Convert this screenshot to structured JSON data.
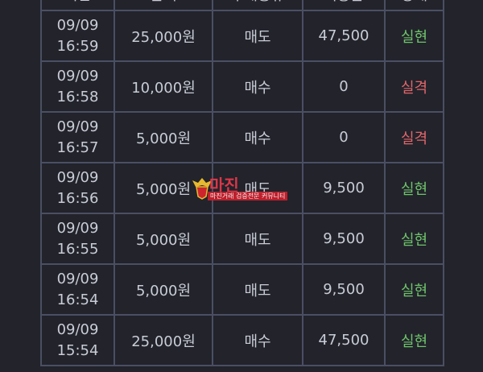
{
  "table": {
    "headers": [
      "시간",
      "금액",
      "구매종류",
      "적중금",
      "상태"
    ],
    "rows": [
      {
        "date": "09/09",
        "time": "16:59",
        "amount": "25,000원",
        "type": "매도",
        "payout": "47,500",
        "status": "실현"
      },
      {
        "date": "09/09",
        "time": "16:58",
        "amount": "10,000원",
        "type": "매수",
        "payout": "0",
        "status": "실격"
      },
      {
        "date": "09/09",
        "time": "16:57",
        "amount": "5,000원",
        "type": "매수",
        "payout": "0",
        "status": "실격"
      },
      {
        "date": "09/09",
        "time": "16:56",
        "amount": "5,000원",
        "type": "매도",
        "payout": "9,500",
        "status": "실현"
      },
      {
        "date": "09/09",
        "time": "16:55",
        "amount": "5,000원",
        "type": "매도",
        "payout": "9,500",
        "status": "실현"
      },
      {
        "date": "09/09",
        "time": "16:54",
        "amount": "5,000원",
        "type": "매도",
        "payout": "9,500",
        "status": "실현"
      },
      {
        "date": "09/09",
        "time": "15:54",
        "amount": "25,000원",
        "type": "매수",
        "payout": "47,500",
        "status": "실현"
      }
    ]
  },
  "colors": {
    "background": "#22232b",
    "border": "#4a4f63",
    "text": "#c9ccd6",
    "win": "#6fc46a",
    "lose": "#e0666a"
  },
  "watermark": {
    "title": "마진",
    "subtitle": "마진거래 검증전문 커뮤니티",
    "icon": "eagle-badge-icon"
  }
}
